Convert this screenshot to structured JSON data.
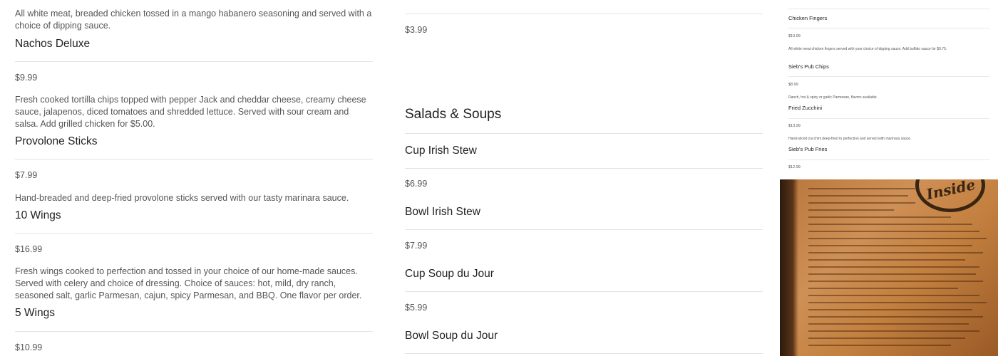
{
  "column1": {
    "items": [
      {
        "desc": "All white meat, breaded chicken tossed in a mango habanero seasoning and served with a choice of dipping sauce."
      },
      {
        "name": "Nachos Deluxe",
        "price": "$9.99",
        "desc": "Fresh cooked tortilla chips topped with pepper Jack and cheddar cheese, creamy cheese sauce, jalapenos, diced tomatoes and shredded lettuce. Served with sour cream and salsa. Add grilled chicken for $5.00."
      },
      {
        "name": "Provolone Sticks",
        "price": "$7.99",
        "desc": "Hand-breaded and deep-fried provolone sticks served with our tasty marinara sauce."
      },
      {
        "name": "10 Wings",
        "price": "$16.99",
        "desc": "Fresh wings cooked to perfection and tossed in your choice of our home-made sauces. Served with celery and choice of dressing. Choice of sauces: hot, mild, dry ranch, seasoned salt, garlic Parmesan, cajun, spicy Parmesan, and BBQ. One flavor per order."
      },
      {
        "name": "5 Wings",
        "price": "$10.99"
      }
    ]
  },
  "column2": {
    "top_price": "$3.99",
    "section_title": "Salads & Soups",
    "items": [
      {
        "name": "Cup Irish Stew",
        "price": "$6.99"
      },
      {
        "name": "Bowl Irish Stew",
        "price": "$7.99"
      },
      {
        "name": "Cup Soup du Jour",
        "price": "$5.99"
      },
      {
        "name": "Bowl Soup du Jour"
      }
    ]
  },
  "column3": {
    "items": [
      {
        "name": "Chicken Fingers",
        "price": "$10.99",
        "desc": "All white meat chicken fingers served with your choice of dipping sauce. Add buffalo sauce for $0.75."
      },
      {
        "name": "Sieb's Pub Chips",
        "price": "$8.99",
        "desc": "Ranch, hot & spicy or garlic Parmesan, flavors available."
      },
      {
        "name": "Fried Zucchini",
        "price": "$13.99",
        "desc": "Hand-sliced zucchini deep-fried to perfection and served with marinara sauce."
      },
      {
        "name": "Sieb's Pub Fries",
        "price": "$12.99"
      }
    ]
  },
  "photo": {
    "logo_text": "Inside"
  }
}
